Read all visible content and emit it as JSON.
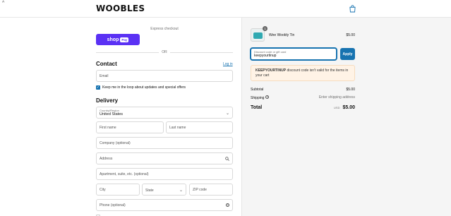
{
  "header": {
    "back_icon": "chevron-up-small-icon",
    "logo": "WOOBLES",
    "cart_icon": "shopping-bag-icon"
  },
  "express": {
    "label": "Express checkout",
    "shoppay_label": "shop",
    "shoppay_badge": "Pay",
    "or_label": "OR"
  },
  "contact": {
    "title": "Contact",
    "login_label": "Log in",
    "email_placeholder": "Email",
    "newsletter_label": "Keep me in the loop about updates and special offers",
    "newsletter_checked": true
  },
  "delivery": {
    "title": "Delivery",
    "country_label": "Country/Region",
    "country_value": "United States",
    "first_name_placeholder": "First name",
    "last_name_placeholder": "Last name",
    "company_placeholder": "Company (optional)",
    "address_placeholder": "Address",
    "apartment_placeholder": "Apartment, suite, etc. (optional)",
    "city_placeholder": "City",
    "state_placeholder": "State",
    "zip_placeholder": "ZIP code",
    "phone_placeholder": "Phone (optional)"
  },
  "summary": {
    "product": {
      "name": "Wee Woobly Tin",
      "price": "$5.00",
      "quantity": "1"
    },
    "discount": {
      "label": "Discount code or gift card",
      "value": "keepyourtinup",
      "apply_label": "Apply",
      "error_code": "KEEPYOURTINUP",
      "error_message": " discount code isn't valid for the items in your cart"
    },
    "subtotal_label": "Subtotal",
    "subtotal_value": "$5.00",
    "shipping_label": "Shipping",
    "shipping_value": "Enter shipping address",
    "total_label": "Total",
    "total_currency": "USD",
    "total_value": "$5.00"
  },
  "colors": {
    "accent": "#1773b0",
    "shoppay": "#5a31f4",
    "error_bg": "#fff3e6"
  }
}
